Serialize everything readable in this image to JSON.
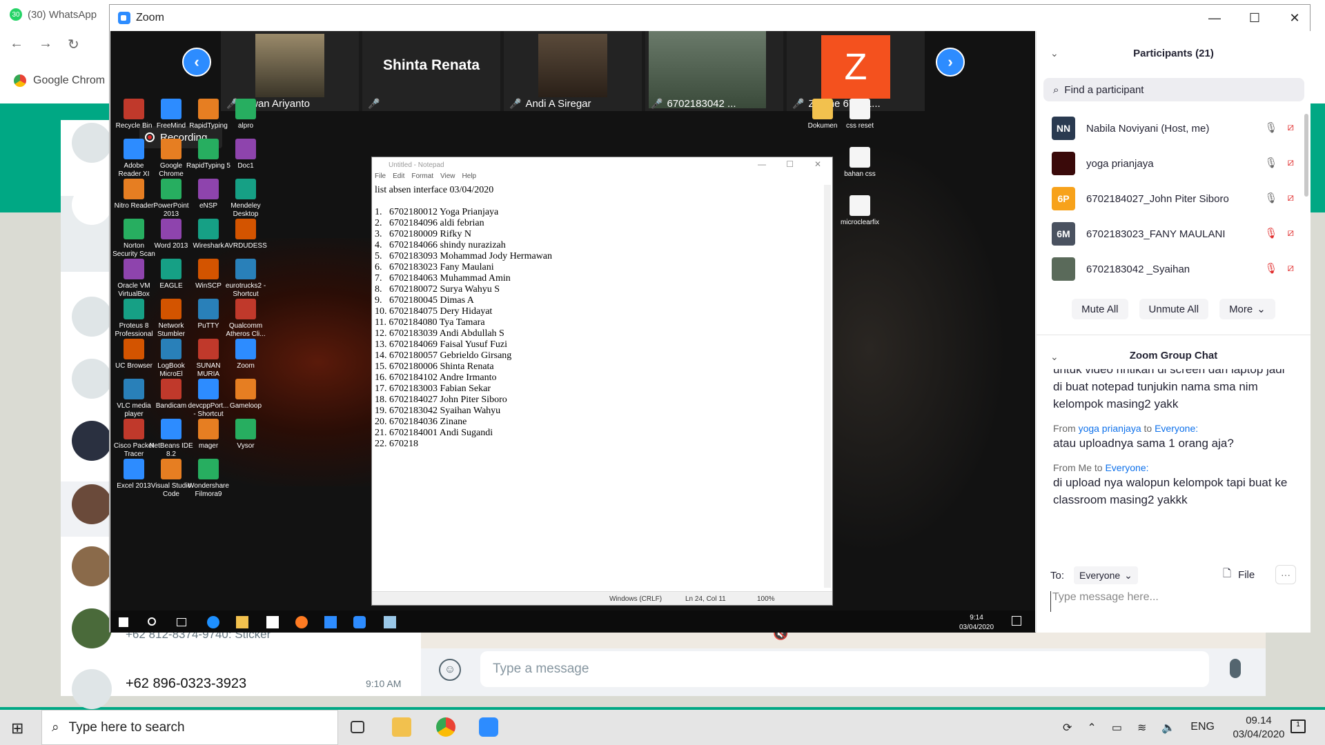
{
  "browser": {
    "tab_badge": "30",
    "tab_title": "(30) WhatsApp",
    "bookmark": "Google Chrom"
  },
  "whatsapp": {
    "row1_text": "+62 812-8374-9740: Sticker",
    "row2_name": "+62 896-0323-3923",
    "row2_time": "9:10 AM",
    "composer_placeholder": "Type a message"
  },
  "zoom": {
    "window_title": "Zoom",
    "controls": {
      "minimize": "—",
      "maximize": "☐",
      "close": "✕"
    },
    "recording": "Recording...",
    "video_strip": [
      {
        "name": "Iswan Ariyanto"
      },
      {
        "name": "",
        "big_label": "Shinta Renata"
      },
      {
        "name": "Andi A Siregar"
      },
      {
        "name": "6702183042 ..."
      },
      {
        "name": "Zidane 67021...",
        "avatar_letter": "Z"
      }
    ],
    "desktop_icons": [
      [
        "Recycle Bin",
        "FreeMind",
        "RapidTyping",
        "alpro"
      ],
      [
        "Adobe Reader XI",
        "Google Chrome",
        "RapidTyping 5",
        "Doc1"
      ],
      [
        "Nitro Reader",
        "PowerPoint 2013",
        "eNSP",
        "Mendeley Desktop"
      ],
      [
        "Norton Security Scan",
        "Word 2013",
        "Wireshark",
        "AVRDUDESS"
      ],
      [
        "Oracle VM VirtualBox",
        "EAGLE",
        "WinSCP",
        "eurotrucks2 - Shortcut"
      ],
      [
        "Proteus 8 Professional",
        "Network Stumbler",
        "PuTTY",
        "Qualcomm Atheros Cli..."
      ],
      [
        "UC Browser",
        "LogBook MicroEl",
        "SUNAN MURIA",
        "Zoom"
      ],
      [
        "VLC media player",
        "Bandicam",
        "devcppPort... - Shortcut",
        "Gameloop"
      ],
      [
        "Cisco Packet Tracer",
        "NetBeans IDE 8.2",
        "mager",
        "Vysor"
      ],
      [
        "Excel 2013",
        "Visual Studio Code",
        "Wondershare Filmora9",
        ""
      ]
    ],
    "desktop_right_icons": [
      "Dokumen",
      "css reset",
      "bahan css",
      "microclearfix"
    ],
    "notepad": {
      "title": "Untitled - Notepad",
      "menu": [
        "File",
        "Edit",
        "Format",
        "View",
        "Help"
      ],
      "content": "list absen interface 03/04/2020\n\n1.   6702180012 Yoga Prianjaya\n2.   6702184096 aldi febrian\n3.   6702180009 Rifky N\n4.   6702184066 shindy nurazizah\n5.   6702183093 Mohammad Jody Hermawan\n6.   6702183023 Fany Maulani\n7.   6702184063 Muhammad Amin\n8.   6702180072 Surya Wahyu S\n9.   6702180045 Dimas A\n10. 6702184075 Dery Hidayat\n11. 6702184080 Tya Tamara\n12. 6702183039 Andi Abdullah S\n13. 6702184069 Faisal Yusuf Fuzi\n14. 6702180057 Gebrieldo Girsang\n15. 6702180006 Shinta Renata\n16. 6702184102 Andre Irmanto\n17. 6702183003 Fabian Sekar\n18. 6702184027 John Piter Siboro\n19. 6702183042 Syaihan Wahyu\n20. 6702184036 Zinane\n21. 6702184001 Andi Sugandi\n22. 670218",
      "status_eol": "Windows (CRLF)",
      "status_pos": "Ln 24, Col 11",
      "status_zoom": "100%"
    },
    "remote_clock": {
      "time": "9:14",
      "date": "03/04/2020"
    },
    "participants": {
      "header": "Participants (21)",
      "search_placeholder": "Find a participant",
      "list": [
        {
          "initials": "NN",
          "name": "Nabila Noviyani (Host, me)",
          "color": "#2a3a50"
        },
        {
          "initials": "",
          "name": "yoga prianjaya",
          "color": "#3a0a0a"
        },
        {
          "initials": "6P",
          "name": "6702184027_John Piter Siboro",
          "color": "#f7a21b"
        },
        {
          "initials": "6M",
          "name": "6702183023_FANY MAULANI",
          "color": "#4a5260"
        },
        {
          "initials": "",
          "name": "6702183042 _Syaihan",
          "color": "#5a6a5a"
        }
      ],
      "mute_all": "Mute All",
      "unmute_all": "Unmute All",
      "more": "More"
    },
    "chat": {
      "header": "Zoom Group Chat",
      "messages": [
        {
          "meta": "",
          "text": "untuk video nntikan di screen dari laptop jadi di buat notepad tunjukin nama sma nim kelompok masing2 yakk"
        },
        {
          "meta_from": "From",
          "sender": "yoga prianjaya",
          "meta_to": "to",
          "target": "Everyone:",
          "text": "atau uploadnya sama 1 orang aja?"
        },
        {
          "meta_from": "From Me to",
          "target": "Everyone:",
          "text": "di upload nya walopun kelompok tapi buat ke classroom masing2 yakkk"
        }
      ],
      "to_label": "To:",
      "to_value": "Everyone",
      "file_label": "File",
      "more_label": "···",
      "input_placeholder": "Type message here..."
    }
  },
  "taskbar": {
    "search_placeholder": "Type here to search",
    "lang": "ENG",
    "time": "09.14",
    "date": "03/04/2020",
    "notif_count": "1"
  }
}
